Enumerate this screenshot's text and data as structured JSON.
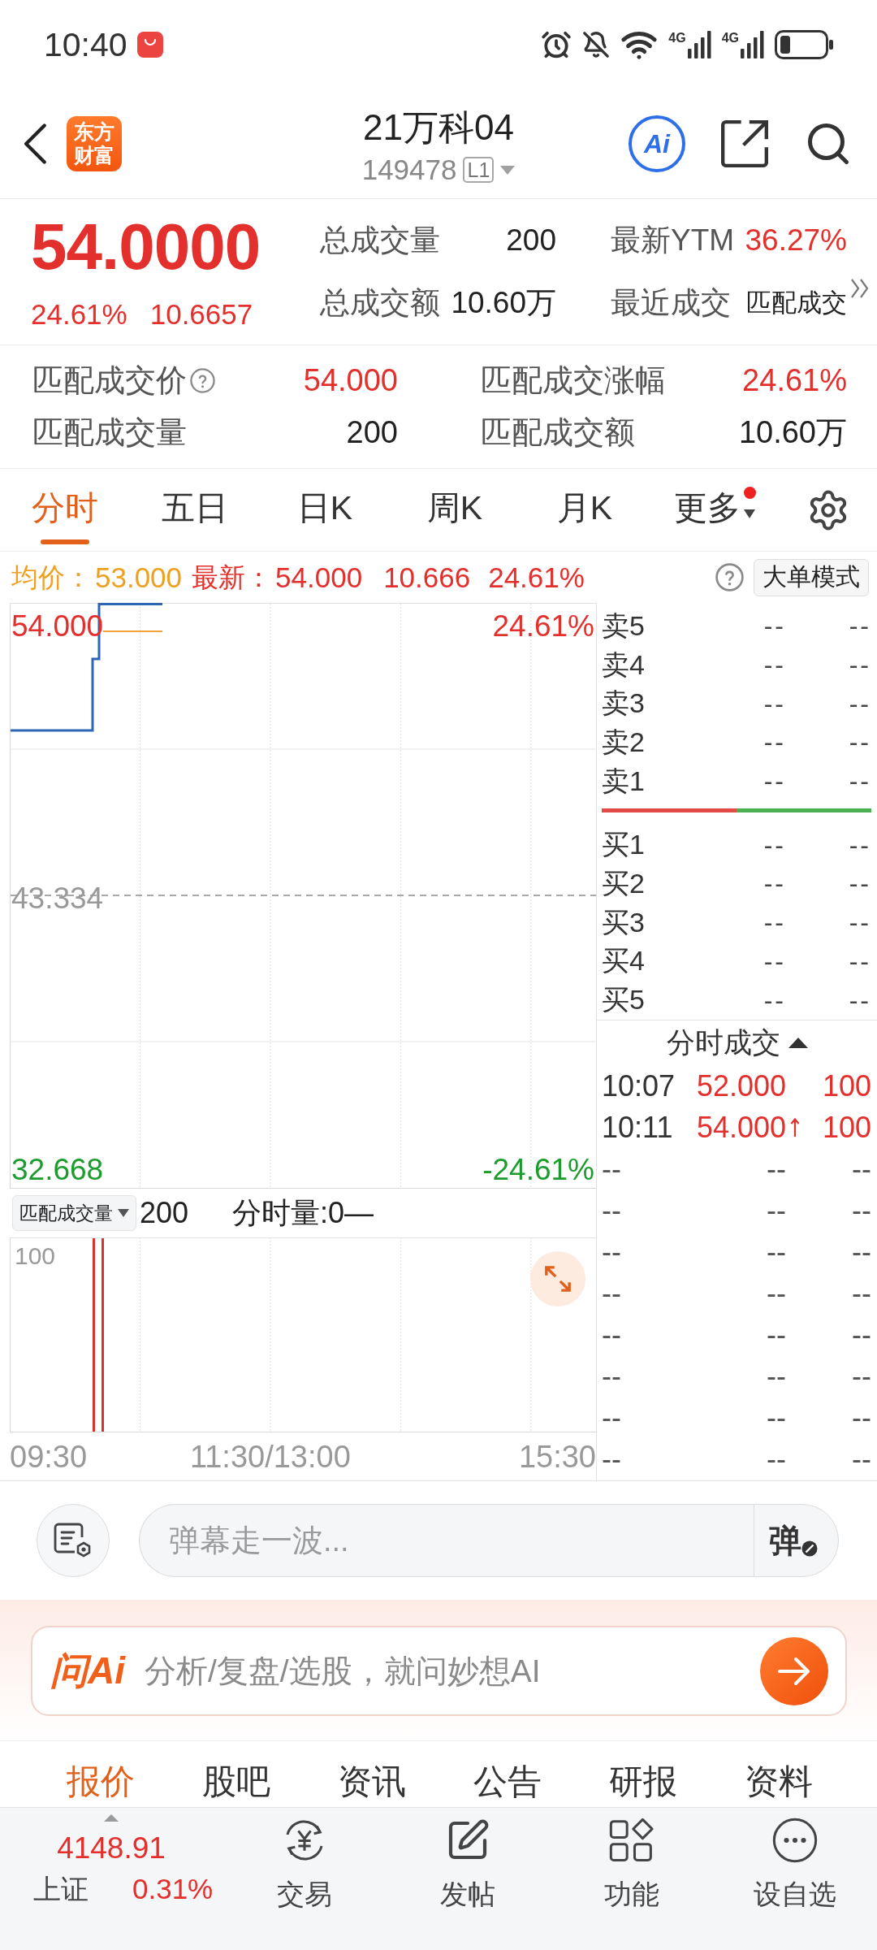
{
  "status_bar": {
    "time": "10:40",
    "networks": [
      "4G",
      "4G"
    ]
  },
  "header": {
    "logo": [
      "东方",
      "财富"
    ],
    "title": "21万科04",
    "code": "149478",
    "level_badge": "L1",
    "ai_button": "Ai"
  },
  "quote": {
    "price": "54.0000",
    "change_pct": "24.61%",
    "change": "10.6657",
    "stats": [
      {
        "label": "总成交量",
        "value": "200",
        "kind": "plain"
      },
      {
        "label": "最新YTM",
        "value": "36.27%",
        "kind": "rise"
      },
      {
        "label": "总成交额",
        "value": "10.60万",
        "kind": "plain"
      },
      {
        "label": "最近成交",
        "value": "匹配成交",
        "kind": "note"
      }
    ]
  },
  "matched": [
    {
      "label": "匹配成交价",
      "value": "54.000",
      "kind": "rise",
      "help": true
    },
    {
      "label": "匹配成交涨幅",
      "value": "24.61%",
      "kind": "rise",
      "help": false
    },
    {
      "label": "匹配成交量",
      "value": "200",
      "kind": "plain",
      "help": false
    },
    {
      "label": "匹配成交额",
      "value": "10.60万",
      "kind": "plain",
      "help": false
    }
  ],
  "chart_tabs": [
    {
      "label": "分时",
      "selected": true,
      "menu": false,
      "badge": false
    },
    {
      "label": "五日",
      "selected": false,
      "menu": false,
      "badge": false
    },
    {
      "label": "日K",
      "selected": false,
      "menu": false,
      "badge": false
    },
    {
      "label": "周K",
      "selected": false,
      "menu": false,
      "badge": false
    },
    {
      "label": "月K",
      "selected": false,
      "menu": false,
      "badge": false
    },
    {
      "label": "更多",
      "selected": false,
      "menu": true,
      "badge": true
    }
  ],
  "info_line": {
    "avg_label": "均价：",
    "avg": "53.000",
    "last_label": "最新：",
    "last": "54.000",
    "change": "10.666",
    "change_pct": "24.61%",
    "mode_button": "大单模式"
  },
  "price_chart": {
    "left_labels": [
      {
        "text": "54.000",
        "kind": "rise"
      },
      {
        "text": "43.334",
        "kind": "flat"
      },
      {
        "text": "32.668",
        "kind": "fall"
      }
    ],
    "right_labels": [
      {
        "text": "24.61%",
        "kind": "rise"
      },
      {
        "text": "-24.61%",
        "kind": "fall"
      }
    ]
  },
  "volume": {
    "selector": "匹配成交量",
    "total": "200",
    "minute_volume": "分时量:0—",
    "axis_label": "100"
  },
  "time_axis": [
    "09:30",
    "11:30/13:00",
    "15:30"
  ],
  "order_book": {
    "asks": [
      {
        "label": "卖5",
        "price": "--",
        "volume": "--"
      },
      {
        "label": "卖4",
        "price": "--",
        "volume": "--"
      },
      {
        "label": "卖3",
        "price": "--",
        "volume": "--"
      },
      {
        "label": "卖2",
        "price": "--",
        "volume": "--"
      },
      {
        "label": "卖1",
        "price": "--",
        "volume": "--"
      }
    ],
    "balance": {
      "level": 0.5
    },
    "bids": [
      {
        "label": "买1",
        "price": "--",
        "volume": "--"
      },
      {
        "label": "买2",
        "price": "--",
        "volume": "--"
      },
      {
        "label": "买3",
        "price": "--",
        "volume": "--"
      },
      {
        "label": "买4",
        "price": "--",
        "volume": "--"
      },
      {
        "label": "买5",
        "price": "--",
        "volume": "--"
      }
    ]
  },
  "trades": {
    "title": "分时成交",
    "rows": [
      {
        "kind": "trade",
        "time": "10:07",
        "price": "52.000",
        "volume": "100",
        "up": false
      },
      {
        "kind": "trade",
        "time": "10:11",
        "price": "54.000",
        "volume": "100",
        "up": true
      },
      {
        "kind": "empty",
        "time": "--",
        "price": "--",
        "volume": "--",
        "up": false
      },
      {
        "kind": "empty",
        "time": "--",
        "price": "--",
        "volume": "--",
        "up": false
      },
      {
        "kind": "empty",
        "time": "--",
        "price": "--",
        "volume": "--",
        "up": false
      },
      {
        "kind": "empty",
        "time": "--",
        "price": "--",
        "volume": "--",
        "up": false
      },
      {
        "kind": "empty",
        "time": "--",
        "price": "--",
        "volume": "--",
        "up": false
      },
      {
        "kind": "empty",
        "time": "--",
        "price": "--",
        "volume": "--",
        "up": false
      },
      {
        "kind": "empty",
        "time": "--",
        "price": "--",
        "volume": "--",
        "up": false
      },
      {
        "kind": "empty",
        "time": "--",
        "price": "--",
        "volume": "--",
        "up": false
      }
    ]
  },
  "comment_bar": {
    "placeholder": "弹幕走一波...",
    "toggle": "弹"
  },
  "ai_bar": {
    "logo": "问Ai",
    "prompt": "分析/复盘/选股，就问妙想AI"
  },
  "content_tabs": [
    {
      "label": "报价",
      "selected": true
    },
    {
      "label": "股吧",
      "selected": false
    },
    {
      "label": "资讯",
      "selected": false
    },
    {
      "label": "公告",
      "selected": false
    },
    {
      "label": "研报",
      "selected": false
    },
    {
      "label": "资料",
      "selected": false
    }
  ],
  "bottom_nav": {
    "index": {
      "value": "4148.91",
      "name": "上证",
      "change_pct": "0.31%"
    },
    "items": [
      {
        "label": "交易",
        "kind": "trade"
      },
      {
        "label": "发帖",
        "kind": "post"
      },
      {
        "label": "功能",
        "kind": "grid"
      },
      {
        "label": "设自选",
        "kind": "more"
      }
    ]
  }
}
